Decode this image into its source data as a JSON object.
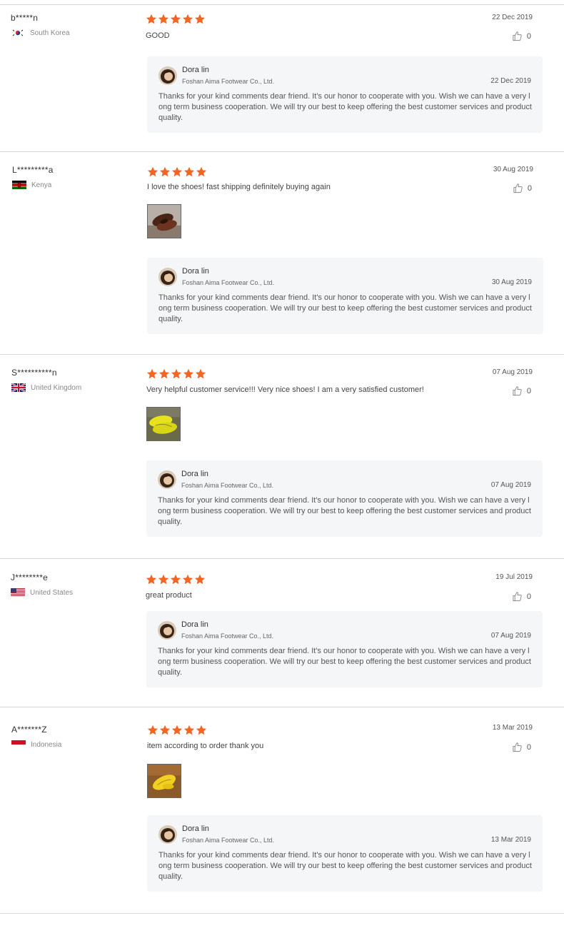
{
  "reviews": [
    {
      "username": "b*****n",
      "country": "South Korea",
      "flag_icon": "south-korea-flag-icon",
      "rating": 5,
      "date": "22 Dec 2019",
      "text": "GOOD",
      "likes": "0",
      "has_photo": false,
      "reply": {
        "name": "Dora lin",
        "company": "Foshan Aima Footwear Co., Ltd.",
        "date": "22 Dec 2019",
        "text": "Thanks for your kind comments dear friend. It's our honor to cooperate with you. Wish we can have a very long term business cooperation. We will try our best to keep offering the best customer services and product quality."
      }
    },
    {
      "username": "L*********a",
      "country": "Kenya",
      "flag_icon": "kenya-flag-icon",
      "rating": 5,
      "date": "30 Aug 2019",
      "text": "I love the shoes! fast shipping definitely buying again",
      "likes": "0",
      "has_photo": true,
      "photo_icon": "brown-shoes-photo",
      "reply": {
        "name": "Dora lin",
        "company": "Foshan Aima Footwear Co., Ltd.",
        "date": "30 Aug 2019",
        "text": "Thanks for your kind comments dear friend. It's our honor to cooperate with you. Wish we can have a very long term business cooperation. We will try our best to keep offering the best customer services and product quality."
      }
    },
    {
      "username": "S**********n",
      "country": "United Kingdom",
      "flag_icon": "united-kingdom-flag-icon",
      "rating": 5,
      "date": "07 Aug 2019",
      "text": "Very helpful customer service!!! Very nice shoes! I am a very satisfied customer!",
      "likes": "0",
      "has_photo": true,
      "photo_icon": "yellow-shoes-photo",
      "reply": {
        "name": "Dora lin",
        "company": "Foshan Aima Footwear Co., Ltd.",
        "date": "07 Aug 2019",
        "text": "Thanks for your kind comments dear friend. It's our honor to cooperate with you. Wish we can have a very long term business cooperation. We will try our best to keep offering the best customer services and product quality."
      }
    },
    {
      "username": "J********e",
      "country": "United States",
      "flag_icon": "united-states-flag-icon",
      "rating": 5,
      "date": "19 Jul 2019",
      "text": "great product",
      "likes": "0",
      "has_photo": false,
      "reply": {
        "name": "Dora lin",
        "company": "Foshan Aima Footwear Co., Ltd.",
        "date": "07 Aug 2019",
        "text": "Thanks for your kind comments dear friend. It's our honor to cooperate with you. Wish we can have a very long term business cooperation. We will try our best to keep offering the best customer services and product quality."
      }
    },
    {
      "username": "A*******Z",
      "country": "Indonesia",
      "flag_icon": "indonesia-flag-icon",
      "rating": 5,
      "date": "13 Mar 2019",
      "text": "item according to order thank you",
      "likes": "0",
      "has_photo": true,
      "photo_icon": "yellow-shoe-photo",
      "reply": {
        "name": "Dora lin",
        "company": "Foshan Aima Footwear Co., Ltd.",
        "date": "13 Mar 2019",
        "text": "Thanks for your kind comments dear friend. It's our honor to cooperate with you. Wish we can have a very long term business cooperation. We will try our best to keep offering the best customer services and product quality."
      }
    }
  ],
  "colors": {
    "star": "#f26522",
    "reply_bg": "#f5f6f7",
    "divider": "#d9d9d9"
  }
}
